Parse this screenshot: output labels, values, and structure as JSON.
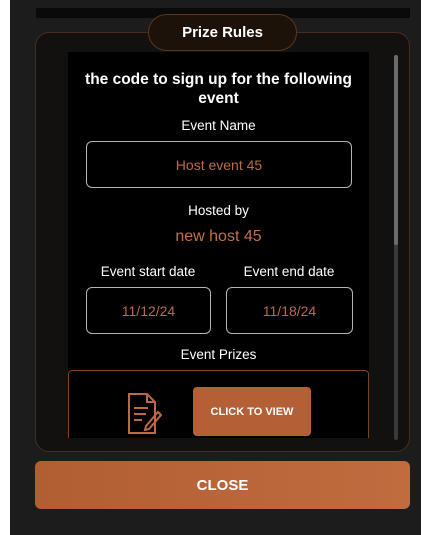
{
  "dialog": {
    "title": "Prize Rules",
    "description": "the code to sign up for the following event",
    "event_name_label": "Event Name",
    "event_name_value": "Host event 45",
    "hosted_by_label": "Hosted by",
    "hosted_by_value": "new host 45",
    "start_date_label": "Event start date",
    "start_date_value": "11/12/24",
    "end_date_label": "Event end date",
    "end_date_value": "11/18/24",
    "prizes_label": "Event Prizes",
    "view_button_label": "CLICK TO VIEW",
    "close_button_label": "CLOSE",
    "scroll_position": 0
  },
  "colors": {
    "accent": "#b45f35",
    "value_text": "#b86b45",
    "panel_border": "#4a2c1a",
    "background": "#000000"
  },
  "icons": {
    "prize_document": "document-edit-icon"
  }
}
